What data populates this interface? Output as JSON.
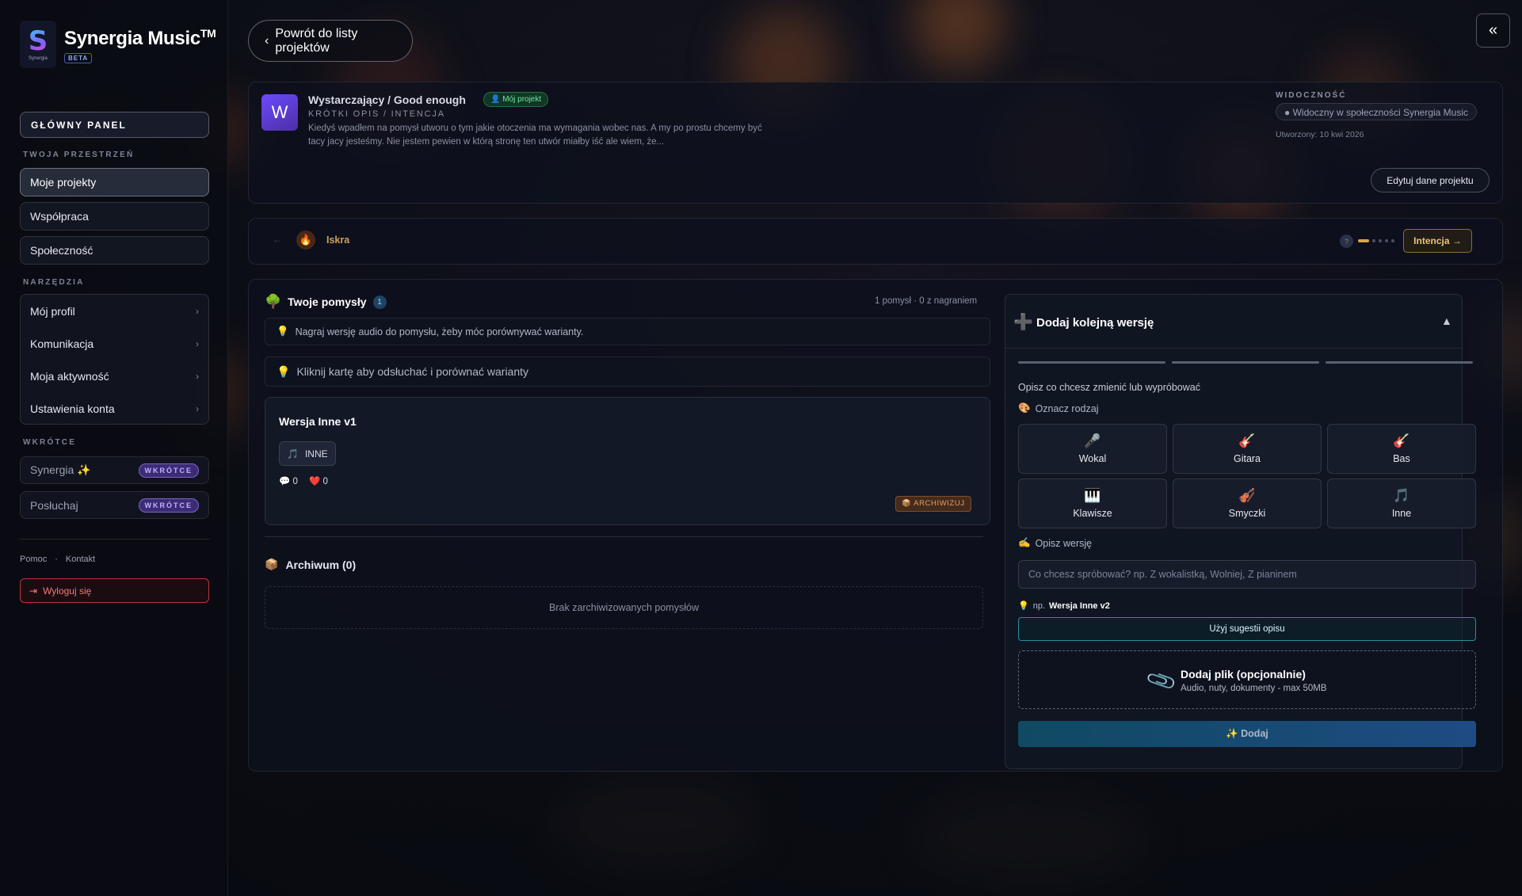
{
  "brand": {
    "title": "Synergia Music",
    "trademark": "TM",
    "badge": "BETA",
    "logo_letter": "S",
    "logo_caption": "Synergia"
  },
  "sidebar": {
    "main_panel": "GŁÓWNY PANEL",
    "workspace_label": "TWOJA PRZESTRZEŃ",
    "workspace_items": [
      {
        "label": "Moje projekty",
        "active": true
      },
      {
        "label": "Współpraca",
        "active": false
      },
      {
        "label": "Społeczność",
        "active": false
      }
    ],
    "tools_label": "NARZĘDZIA",
    "tools_items": [
      {
        "label": "Mój profil"
      },
      {
        "label": "Komunikacja"
      },
      {
        "label": "Moja aktywność"
      },
      {
        "label": "Ustawienia konta"
      }
    ],
    "soon_label": "WKRÓTCE",
    "soon_items": [
      {
        "label": "Synergia ✨",
        "badge": "WKRÓTCE"
      },
      {
        "label": "Posłuchaj",
        "badge": "WKRÓTCE"
      }
    ],
    "footer_links": [
      "Pomoc",
      "·",
      "Kontakt"
    ],
    "logout": "Wyloguj się"
  },
  "header": {
    "back_label": "Powrót do listy projektów",
    "back_icon": "chevron-left-icon",
    "collapse_icon": "double-chevron-left-icon",
    "collapse_glyph": "«"
  },
  "project": {
    "avatar": "W",
    "title": "Wystarczający / Good enough",
    "owner_badge": "Mój projekt",
    "subtitle": "KRÓTKI OPIS / INTENCJA",
    "description": "Kiedyś wpadłem na pomysł utworu o tym jakie otoczenia ma wymagania wobec nas. A my po prostu chcemy być tacy jacy jesteśmy. Nie jestem pewien w którą stronę ten utwór miałby iść ale wiem, że...",
    "visibility_label": "WIDOCZNOŚĆ",
    "visibility_value": "Widoczny w społeczności Synergia Music",
    "created": "Utworzony: 10 kwi 2026",
    "edit_button": "Edytuj dane projektu"
  },
  "stage": {
    "current": "Iskra",
    "icon": "flame-icon",
    "help": "?",
    "steps_total": 5,
    "step_current": 1,
    "next_button": "Intencja →"
  },
  "ideas": {
    "title": "Twoje pomysły",
    "count": "1",
    "meta": "1 pomysł · 0 z nagraniem",
    "hint_record": "Nagraj wersję audio do pomysłu, żeby móc porównywać warianty.",
    "hint_click": "Kliknij kartę aby odsłuchać i porównać warianty",
    "version": {
      "title": "Wersja Inne v1",
      "tag": "INNE",
      "comments": "0",
      "likes": "0",
      "archive_button": "ARCHIWIZUJ"
    },
    "archive_title": "Archiwum (0)",
    "archive_empty": "Brak zarchiwizowanych pomysłów"
  },
  "add_version": {
    "title": "Dodaj kolejną wersję",
    "progress_steps": 3,
    "description": "Opisz co chcesz zmienić lub wypróbować",
    "type_label": "Oznacz rodzaj",
    "types": [
      {
        "label": "Wokal",
        "icon": "microphone-icon",
        "glyph": "🎤"
      },
      {
        "label": "Gitara",
        "icon": "guitar-icon",
        "glyph": "🎸"
      },
      {
        "label": "Bas",
        "icon": "bass-icon",
        "glyph": "🎸"
      },
      {
        "label": "Klawisze",
        "icon": "piano-icon",
        "glyph": "🎹"
      },
      {
        "label": "Smyczki",
        "icon": "violin-icon",
        "glyph": "🎻"
      },
      {
        "label": "Inne",
        "icon": "music-note-icon",
        "glyph": "🎵"
      }
    ],
    "describe_label": "Opisz wersję",
    "input_placeholder": "Co chcesz spróbować? np. Z wokalistką, Wolniej, Z pianinem",
    "input_value": "",
    "suggestion_prefix": "np.",
    "suggestion_value": "Wersja Inne v2",
    "use_suggestion": "Użyj sugestii opisu",
    "file_title": "Dodaj plik (opcjonalnie)",
    "file_sub": "Audio, nuty, dokumenty - max 50MB",
    "submit": "✨ Dodaj"
  },
  "colors": {
    "accent_gold": "#d6a54a",
    "accent_teal": "#38bdcd",
    "danger": "#ef4444",
    "success": "#4ade80",
    "purple": "#8b5cf6"
  }
}
